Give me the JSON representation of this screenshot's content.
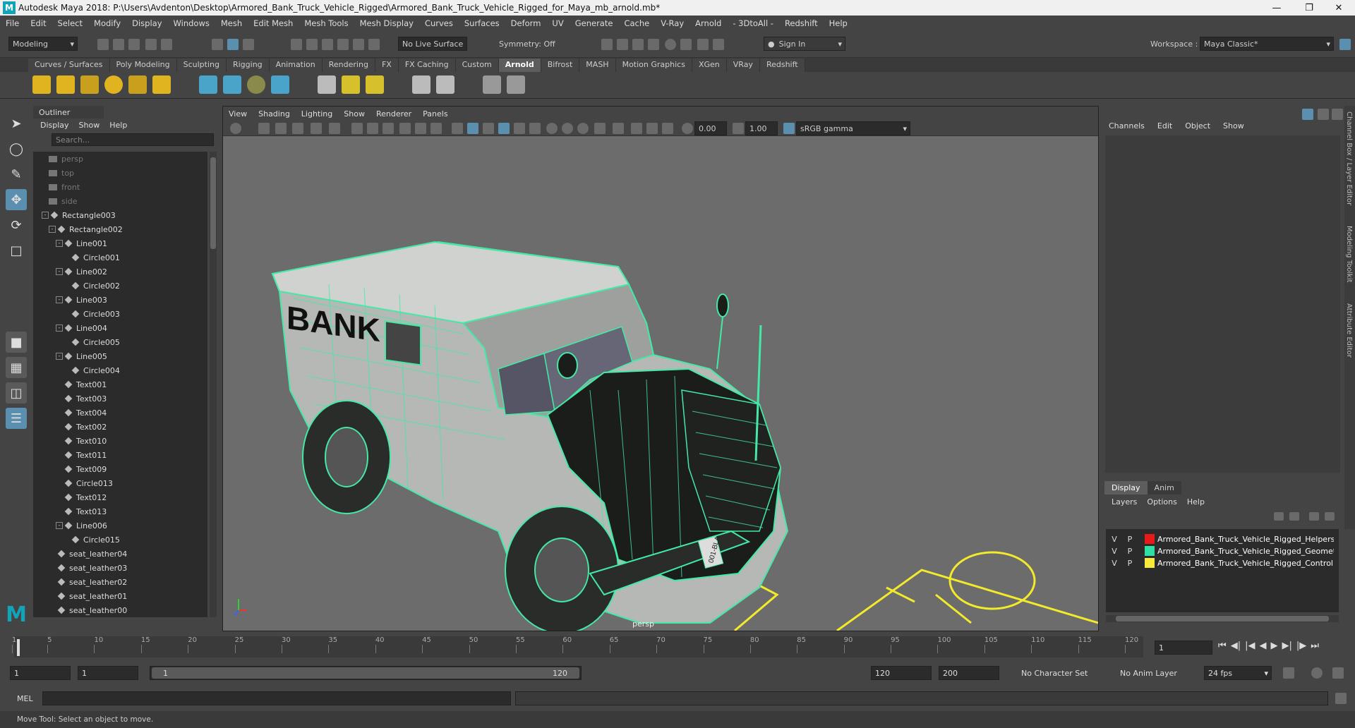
{
  "title": "Autodesk Maya 2018: P:\\Users\\Avdenton\\Desktop\\Armored_Bank_Truck_Vehicle_Rigged\\Armored_Bank_Truck_Vehicle_Rigged_for_Maya_mb_arnold.mb*",
  "menu": [
    "File",
    "Edit",
    "Select",
    "Modify",
    "Display",
    "Windows",
    "Mesh",
    "Edit Mesh",
    "Mesh Tools",
    "Mesh Display",
    "Curves",
    "Surfaces",
    "Deform",
    "UV",
    "Generate",
    "Cache",
    "V-Ray",
    "Arnold",
    "- 3DtoAll -",
    "Redshift",
    "Help"
  ],
  "status": {
    "mode": "Modeling",
    "live_surface": "No Live Surface",
    "symmetry": "Symmetry: Off",
    "sign_in": "Sign In",
    "workspace_label": "Workspace :",
    "workspace": "Maya Classic*"
  },
  "shelf_tabs": [
    "Curves / Surfaces",
    "Poly Modeling",
    "Sculpting",
    "Rigging",
    "Animation",
    "Rendering",
    "FX",
    "FX Caching",
    "Custom",
    "Arnold",
    "Bifrost",
    "MASH",
    "Motion Graphics",
    "XGen",
    "VRay",
    "Redshift"
  ],
  "active_shelf": "Arnold",
  "outliner": {
    "title": "Outliner",
    "menu": [
      "Display",
      "Show",
      "Help"
    ],
    "search": "Search...",
    "rows": [
      {
        "d": 0,
        "t": "persp",
        "k": "cam"
      },
      {
        "d": 0,
        "t": "top",
        "k": "cam"
      },
      {
        "d": 0,
        "t": "front",
        "k": "cam"
      },
      {
        "d": 0,
        "t": "side",
        "k": "cam"
      },
      {
        "d": 0,
        "t": "Rectangle003",
        "e": "-"
      },
      {
        "d": 1,
        "t": "Rectangle002",
        "e": "-"
      },
      {
        "d": 2,
        "t": "Line001",
        "e": "-"
      },
      {
        "d": 3,
        "t": "Circle001"
      },
      {
        "d": 2,
        "t": "Line002",
        "e": "-"
      },
      {
        "d": 3,
        "t": "Circle002"
      },
      {
        "d": 2,
        "t": "Line003",
        "e": "-"
      },
      {
        "d": 3,
        "t": "Circle003"
      },
      {
        "d": 2,
        "t": "Line004",
        "e": "-"
      },
      {
        "d": 3,
        "t": "Circle005"
      },
      {
        "d": 2,
        "t": "Line005",
        "e": "-"
      },
      {
        "d": 3,
        "t": "Circle004"
      },
      {
        "d": 2,
        "t": "Text001"
      },
      {
        "d": 2,
        "t": "Text003"
      },
      {
        "d": 2,
        "t": "Text004"
      },
      {
        "d": 2,
        "t": "Text002"
      },
      {
        "d": 2,
        "t": "Text010"
      },
      {
        "d": 2,
        "t": "Text011"
      },
      {
        "d": 2,
        "t": "Text009"
      },
      {
        "d": 2,
        "t": "Circle013"
      },
      {
        "d": 2,
        "t": "Text012"
      },
      {
        "d": 2,
        "t": "Text013"
      },
      {
        "d": 2,
        "t": "Line006",
        "e": "-"
      },
      {
        "d": 3,
        "t": "Circle015"
      },
      {
        "d": 1,
        "t": "seat_leather04"
      },
      {
        "d": 1,
        "t": "seat_leather03"
      },
      {
        "d": 1,
        "t": "seat_leather02"
      },
      {
        "d": 1,
        "t": "seat_leather01"
      },
      {
        "d": 1,
        "t": "seat_leather00"
      }
    ]
  },
  "viewport": {
    "menu": [
      "View",
      "Shading",
      "Lighting",
      "Show",
      "Renderer",
      "Panels"
    ],
    "val1": "0.00",
    "val2": "1.00",
    "colorspace": "sRGB gamma",
    "camera": "persp",
    "truck_text": "BANK",
    "plate": "001-BLA"
  },
  "channelbox": {
    "menu": [
      "Channels",
      "Edit",
      "Object",
      "Show"
    ],
    "tabs": [
      "Display",
      "Anim"
    ],
    "layer_menu": [
      "Layers",
      "Options",
      "Help"
    ],
    "layers": [
      {
        "v": "V",
        "p": "P",
        "color": "#e8191a",
        "name": "Armored_Bank_Truck_Vehicle_Rigged_Helpers"
      },
      {
        "v": "V",
        "p": "P",
        "color": "#2fe0a4",
        "name": "Armored_Bank_Truck_Vehicle_Rigged_Geometry"
      },
      {
        "v": "V",
        "p": "P",
        "color": "#f7ea3c",
        "name": "Armored_Bank_Truck_Vehicle_Rigged_Controllers"
      }
    ]
  },
  "side_tabs": [
    "Channel Box / Layer Editor",
    "Modeling Toolkit",
    "Attribute Editor"
  ],
  "timeline": {
    "ticks": [
      "1",
      "5",
      "10",
      "15",
      "20",
      "25",
      "30",
      "35",
      "40",
      "45",
      "50",
      "55",
      "60",
      "65",
      "70",
      "75",
      "80",
      "85",
      "90",
      "95",
      "100",
      "105",
      "110",
      "115",
      "120"
    ],
    "current": "1"
  },
  "range": {
    "start": "1",
    "playstart": "1",
    "slider_start": "1",
    "slider_end": "120",
    "playend": "120",
    "end": "200",
    "char_set": "No Character Set",
    "anim_layer": "No Anim Layer",
    "fps": "24 fps"
  },
  "mel": "MEL",
  "help": "Move Tool: Select an object to move."
}
